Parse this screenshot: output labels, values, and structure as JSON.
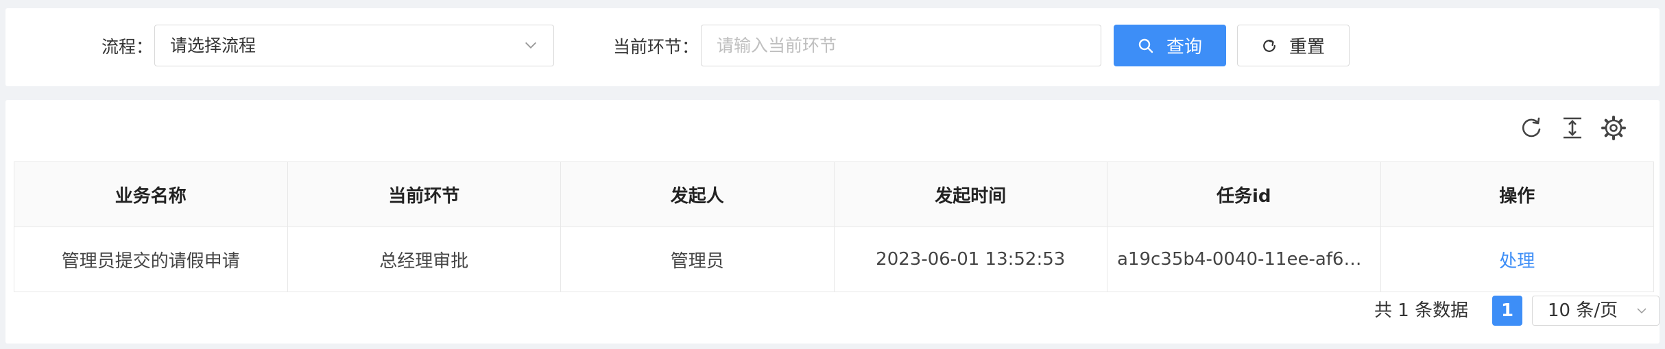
{
  "search": {
    "flow_label": "流程：",
    "flow_select": {
      "value": "请选择流程",
      "icon": "chevron-down-icon"
    },
    "node_label": "当前环节：",
    "node_input": {
      "value": "",
      "placeholder": "请输入当前环节"
    },
    "query_button": {
      "label": "查询",
      "icon": "search-icon"
    },
    "reset_button": {
      "label": "重置",
      "icon": "reload-icon"
    }
  },
  "toolbar": {
    "icons": [
      "refresh-icon",
      "column-height-icon",
      "settings-icon"
    ]
  },
  "table": {
    "columns": [
      "业务名称",
      "当前环节",
      "发起人",
      "发起时间",
      "任务id",
      "操作"
    ],
    "rows": [
      {
        "name": "管理员提交的请假申请",
        "node": "总经理审批",
        "initiator": "管理员",
        "time": "2023-06-01 13:52:53",
        "task_id": "a19c35b4-0040-11ee-af6e...",
        "action": "处理"
      }
    ]
  },
  "pagination": {
    "total_text": "共 1 条数据",
    "current_page": "1",
    "page_size": "10 条/页"
  },
  "colors": {
    "primary": "#3d8ef7",
    "background": "#f0f2f5",
    "border": "#e8e8e8"
  }
}
